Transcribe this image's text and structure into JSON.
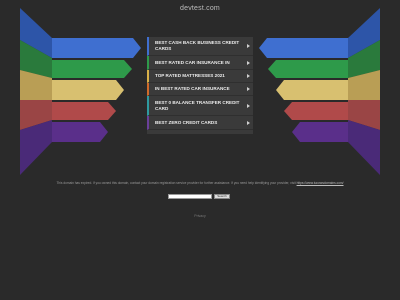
{
  "header": {
    "domain": "devtest.com"
  },
  "links": [
    {
      "label": "BEST CASH BACK BUSINESS CREDIT CARDS",
      "accent": "#3f6fd0"
    },
    {
      "label": "BEST RATED CAR INSURANCE IN",
      "accent": "#2e9a4a"
    },
    {
      "label": "TOP RATED MATTRESSES 2021",
      "accent": "#d8b048"
    },
    {
      "label": "IN BEST RATED CAR INSURANCE",
      "accent": "#d06a2a"
    },
    {
      "label": "BEST 0 BALANCE TRANSFER CREDIT CARD",
      "accent": "#2e9aa0"
    },
    {
      "label": "BEST ZERO CREDIT CARDS",
      "accent": "#6a3f9a"
    }
  ],
  "footer": {
    "disclaimer": "This domain has expired. If you owned this domain, contact your domain registration service provider for further assistance. If you need help identifying your provider, visit",
    "disclaimer_link": "https://www.tucowsdomains.com/",
    "search_placeholder": "",
    "search_button": "Search",
    "privacy": "Privacy"
  },
  "colors": {
    "background": "#2a2a2a",
    "blue": "#3f6fd0",
    "green": "#2e9a4a",
    "yellow": "#d8c070",
    "red": "#b04a4a",
    "purple": "#5a2f8a"
  }
}
